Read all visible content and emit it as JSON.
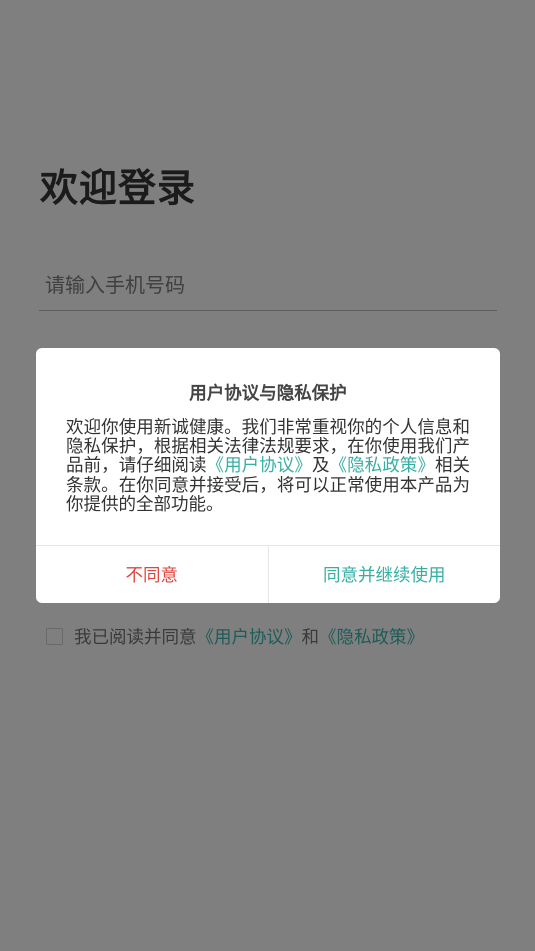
{
  "login": {
    "title": "欢迎登录",
    "phone_placeholder": "请输入手机号码",
    "agree_prefix": "我已阅读并同意",
    "agree_link_user": "《用户协议》",
    "agree_and": "和",
    "agree_link_privacy": "《隐私政策》"
  },
  "dialog": {
    "title": "用户协议与隐私保护",
    "body_part1": "欢迎你使用新诚健康。我们非常重视你的个人信息和隐私保护，根据相关法律法规要求，在你使用我们产品前，请仔细阅读",
    "link_user": "《用户协议》",
    "body_and": "及",
    "link_privacy": "《隐私政策》",
    "body_part2": "相关条款。在你同意并接受后，将可以正常使用本产品为你提供的全部功能。",
    "disagree_label": "不同意",
    "agree_label": "同意并继续使用"
  },
  "colors": {
    "overlay_bg": "#7f7f7f",
    "accent": "#37aea4",
    "danger": "#e0463d"
  }
}
